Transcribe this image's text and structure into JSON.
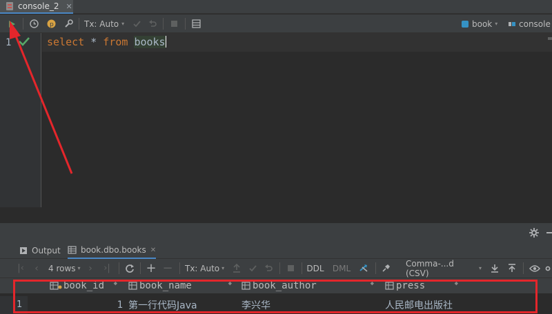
{
  "tab": {
    "title": "console_2"
  },
  "toolbar": {
    "tx_label": "Tx: Auto",
    "schema_label": "book",
    "session_label": "console"
  },
  "editor": {
    "line_number": "1",
    "keyword_select": "select",
    "star": "*",
    "keyword_from": "from",
    "table": "books"
  },
  "services": {
    "output_tab": "Output",
    "result_tab": "book.dbo.books"
  },
  "result_toolbar": {
    "rows_label": "4 rows",
    "tx_label": "Tx: Auto",
    "ddl": "DDL",
    "dml": "DML",
    "export_format": "Comma-...d (CSV)"
  },
  "grid": {
    "columns": [
      "book_id",
      "book_name",
      "book_author",
      "press"
    ],
    "rows": [
      {
        "row_num": "1",
        "book_id": "1",
        "book_name": "第一行代码Java",
        "book_author": "李兴华",
        "press": "人民邮电出版社"
      }
    ]
  },
  "colors": {
    "annotation_red": "#e4262b",
    "run_green": "#59a869",
    "accent_blue": "#4a88c7"
  }
}
